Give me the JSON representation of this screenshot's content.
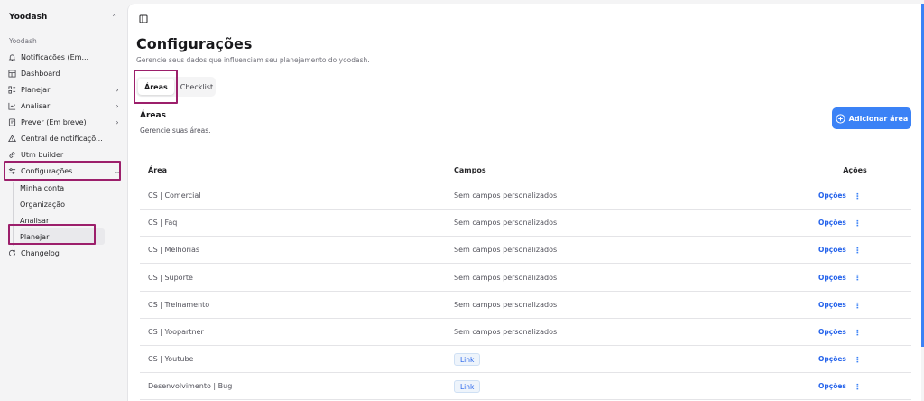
{
  "workspace": {
    "name": "Yoodash"
  },
  "sidebar": {
    "group_label": "Yoodash",
    "items": [
      {
        "label": "Notificações (Em...",
        "icon": "bell-icon",
        "chevron": false
      },
      {
        "label": "Dashboard",
        "icon": "dashboard-icon",
        "chevron": false
      },
      {
        "label": "Planejar",
        "icon": "kanban-icon",
        "chevron": true
      },
      {
        "label": "Analisar",
        "icon": "chart-line-icon",
        "chevron": true
      },
      {
        "label": "Prever (Em breve)",
        "icon": "box-icon",
        "chevron": true
      },
      {
        "label": "Central de notificaçõ...",
        "icon": "alert-icon",
        "chevron": false
      },
      {
        "label": "Utm builder",
        "icon": "link-icon",
        "chevron": false
      },
      {
        "label": "Configurações",
        "icon": "sliders-icon",
        "chevron": true
      },
      {
        "label": "Changelog",
        "icon": "refresh-icon",
        "chevron": false
      }
    ],
    "sub_items": [
      {
        "label": "Minha conta"
      },
      {
        "label": "Organização"
      },
      {
        "label": "Analisar"
      },
      {
        "label": "Planejar"
      }
    ]
  },
  "main": {
    "title": "Configurações",
    "subtitle": "Gerencie seus dados que influenciam seu planejamento do yoodash.",
    "tabs": [
      {
        "label": "Áreas"
      },
      {
        "label": "Checklist"
      }
    ],
    "section_title": "Áreas",
    "section_subtitle": "Gerencie suas áreas.",
    "add_button_label": "Adicionar área"
  },
  "table": {
    "headers": {
      "area": "Área",
      "campos": "Campos",
      "acoes": "Ações"
    },
    "rows": [
      {
        "area": "CS | Comercial",
        "campos": "Sem campos personalizados",
        "campos_badge": false,
        "acao": "Opções"
      },
      {
        "area": "CS | Faq",
        "campos": "Sem campos personalizados",
        "campos_badge": false,
        "acao": "Opções"
      },
      {
        "area": "CS | Melhorias",
        "campos": "Sem campos personalizados",
        "campos_badge": false,
        "acao": "Opções"
      },
      {
        "area": "CS | Suporte",
        "campos": "Sem campos personalizados",
        "campos_badge": false,
        "acao": "Opções"
      },
      {
        "area": "CS | Treinamento",
        "campos": "Sem campos personalizados",
        "campos_badge": false,
        "acao": "Opções"
      },
      {
        "area": "CS | Yoopartner",
        "campos": "Sem campos personalizados",
        "campos_badge": false,
        "acao": "Opções"
      },
      {
        "area": "CS | Youtube",
        "campos": "Link",
        "campos_badge": true,
        "acao": "Opções"
      },
      {
        "area": "Desenvolvimento | Bug",
        "campos": "Link",
        "campos_badge": true,
        "acao": "Opções"
      }
    ]
  },
  "colors": {
    "accent": "#3b82f6",
    "highlight": "#9c1f6b",
    "link": "#2563eb"
  }
}
